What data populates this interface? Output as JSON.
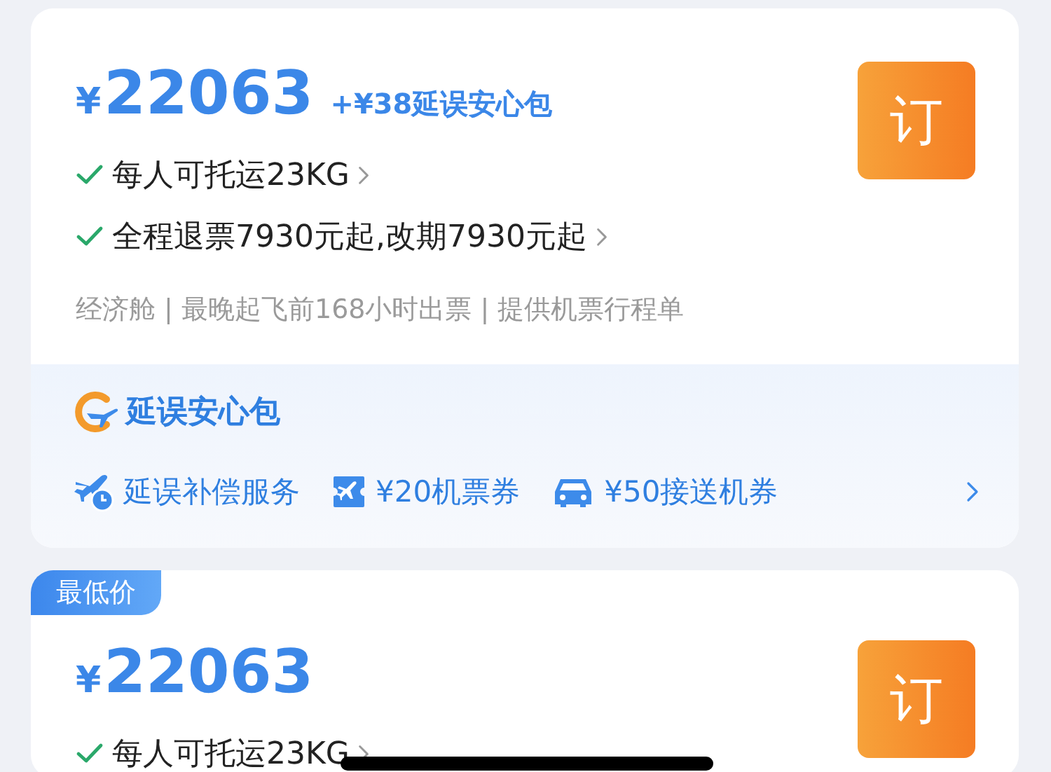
{
  "cards": [
    {
      "currency": "¥",
      "price": "22063",
      "addon": "+¥38延误安心包",
      "features": [
        "每人可托运23KG",
        "全程退票7930元起,改期7930元起"
      ],
      "info": "经济舱 | 最晚起飞前168小时出票 | 提供机票行程单",
      "book_button": "订",
      "insurance": {
        "title": "延误安心包",
        "items": [
          {
            "kind": "delay",
            "text": "延误补偿服务"
          },
          {
            "kind": "ticket",
            "text": "¥20机票券"
          },
          {
            "kind": "car",
            "text": "¥50接送机券"
          }
        ]
      }
    },
    {
      "badge": "最低价",
      "currency": "¥",
      "price": "22063",
      "features": [
        "每人可托运23KG"
      ],
      "book_button": "订"
    }
  ]
}
